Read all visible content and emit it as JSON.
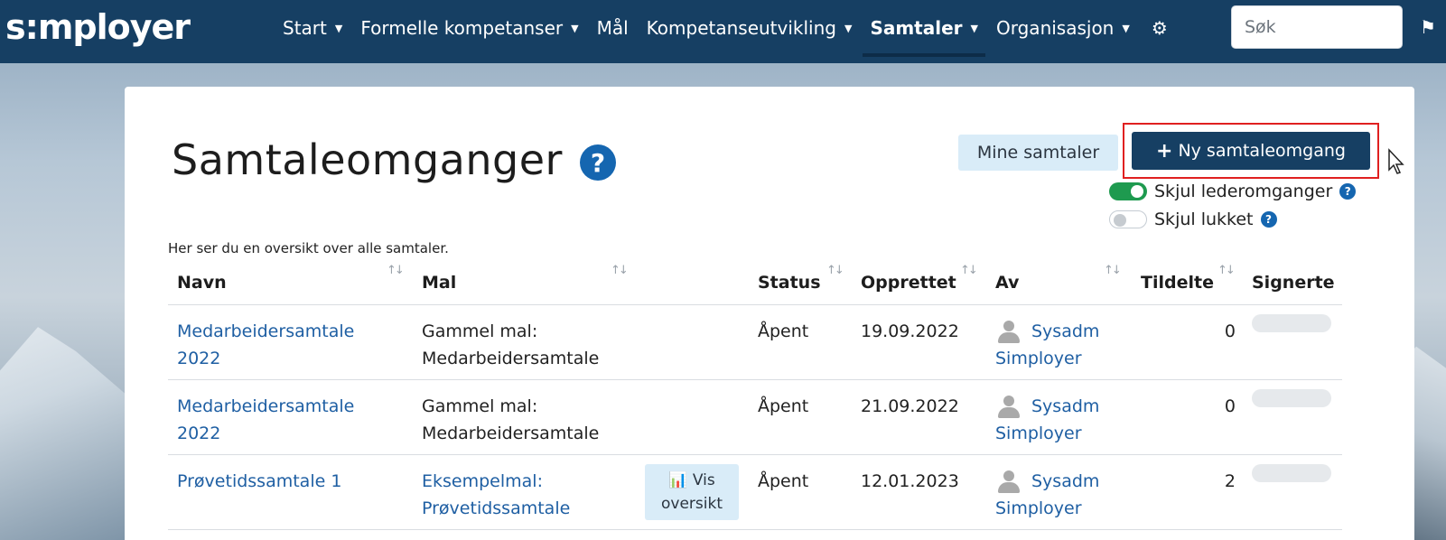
{
  "brand": "s:mployer",
  "nav": {
    "items": [
      {
        "label": "Start",
        "caret": true
      },
      {
        "label": "Formelle kompetanser",
        "caret": true
      },
      {
        "label": "Mål",
        "caret": false
      },
      {
        "label": "Kompetanseutvikling",
        "caret": true
      },
      {
        "label": "Samtaler",
        "caret": true,
        "active": true
      },
      {
        "label": "Organisasjon",
        "caret": true
      }
    ],
    "search_placeholder": "Søk"
  },
  "page": {
    "title": "Samtaleomganger",
    "help": "?",
    "mine_button": "Mine samtaler",
    "new_button": "Ny samtaleomgang",
    "toggles": [
      {
        "label": "Skjul lederomganger",
        "on": true
      },
      {
        "label": "Skjul lukket",
        "on": false
      }
    ],
    "intro": "Her ser du en oversikt over alle samtaler."
  },
  "table": {
    "headers": {
      "name": "Navn",
      "template": "Mal",
      "status": "Status",
      "created": "Opprettet",
      "by": "Av",
      "assigned": "Tildelte",
      "signed": "Signerte"
    },
    "rows": [
      {
        "name_l1": "Medarbeidersamtale",
        "name_l2": "2022",
        "template_l1": "Gammel mal:",
        "template_l2": "Medarbeidersamtale",
        "status": "Åpent",
        "created": "19.09.2022",
        "by_l1": "Sysadm",
        "by_l2": "Simployer",
        "assigned": "0"
      },
      {
        "name_l1": "Medarbeidersamtale",
        "name_l2": "2022",
        "template_l1": "Gammel mal:",
        "template_l2": "Medarbeidersamtale",
        "status": "Åpent",
        "created": "21.09.2022",
        "by_l1": "Sysadm",
        "by_l2": "Simployer",
        "assigned": "0"
      },
      {
        "name_l1": "Prøvetidssamtale 1",
        "name_l2": "",
        "template_l1": "Eksempelmal:",
        "template_l2": "Prøvetidssamtale",
        "overview_l1": "Vis",
        "overview_l2": "oversikt",
        "status": "Åpent",
        "created": "12.01.2023",
        "by_l1": "Sysadm",
        "by_l2": "Simployer",
        "assigned": "2"
      }
    ]
  },
  "colors": {
    "navbar": "#163f63",
    "primary_button": "#163f63",
    "link": "#1f5fa3",
    "highlight_outline": "#e02020",
    "toggle_on": "#1e9a4f"
  }
}
